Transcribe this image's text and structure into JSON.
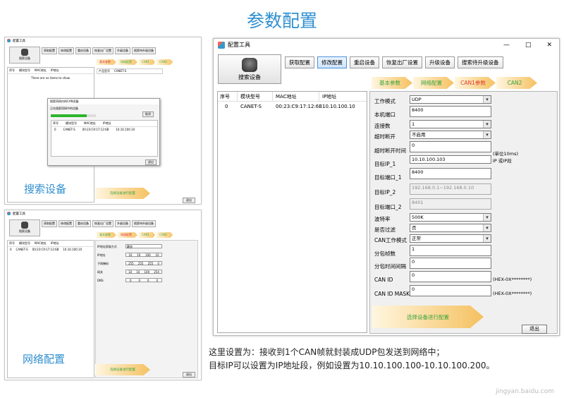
{
  "page_title": "参数配置",
  "captions": {
    "search": "搜索设备",
    "network": "网络配置"
  },
  "thumb1": {
    "title": "配置工具",
    "search_label": "搜索设备",
    "buttons": [
      "获取配置",
      "修改配置",
      "重启设备",
      "恢复出厂设置",
      "升级设备",
      "搜索待升级设备"
    ],
    "tabs": [
      "基本参数",
      "网络配置",
      "CAN1",
      "CAN2"
    ],
    "cols": [
      "序号",
      "模块型号",
      "MAC地址",
      "IP地址"
    ],
    "empty": "There are no items to show.",
    "dialog_title": "搜索同网内的CAN设备",
    "dialog_msg": "正在搜索同网中的设备",
    "dialog_cancel": "取消",
    "dialog_cols": [
      "序号",
      "模块型号",
      "MAC地址",
      "IP地址"
    ],
    "dialog_row": [
      "0",
      "CANET-S",
      "00:23:C9:17:12:6B",
      "10.10.100.10"
    ],
    "dialog_ok": "退出",
    "side_label": "产品型号",
    "side_value": "CANET-S",
    "apply": "选择设备进行配置",
    "exit": "退出"
  },
  "thumb2": {
    "title": "配置工具",
    "search_label": "搜索设备",
    "buttons": [
      "获取配置",
      "修改配置",
      "重启设备",
      "恢复出厂设置",
      "升级设备",
      "搜索待升级设备"
    ],
    "tabs": [
      "基本参数",
      "网络配置",
      "CAN1",
      "CAN2"
    ],
    "cols": [
      "序号",
      "模块型号",
      "MAC地址",
      "IP地址"
    ],
    "row": [
      "0",
      "CANET-S",
      "00:23:C9:17:12:6B",
      "10.10.100.10"
    ],
    "labels": [
      "IP地址获取方式",
      "IP地址",
      "子网掩码",
      "网关",
      "DNS"
    ],
    "mode": "静态",
    "ip": [
      "10",
      "10",
      "100",
      "10"
    ],
    "mask": [
      "255",
      "255",
      "255",
      "0"
    ],
    "gw": [
      "10",
      "10",
      "100",
      "254"
    ],
    "dns": [
      "0",
      "0",
      "0",
      "0"
    ],
    "apply": "选择设备进行配置",
    "exit": "退出"
  },
  "main": {
    "title": "配置工具",
    "controls": {
      "min": "—",
      "max": "□",
      "close": "✕"
    },
    "search_label": "搜索设备",
    "buttons": [
      "获取配置",
      "修改配置",
      "重启设备",
      "恢复出厂设置",
      "升级设备",
      "搜索待升级设备"
    ],
    "tabs": [
      "基本参数",
      "网络配置",
      "CAN1参数",
      "CAN2"
    ],
    "cols": [
      "序号",
      "模块型号",
      "MAC地址",
      "IP地址"
    ],
    "row": [
      "0",
      "CANET-S",
      "00:23:C9:17:12:6B",
      "10.10.100.10"
    ],
    "fields": {
      "work_mode_label": "工作模式",
      "work_mode": "UDP",
      "local_port_label": "本机端口",
      "local_port": "8400",
      "conn_label": "连接数",
      "conn": "1",
      "timeout_label": "超时断开",
      "timeout": "不启用",
      "timeout_time_label": "超时断开时间",
      "timeout_time": "0",
      "timeout_unit": "(单位10ms)",
      "target_ip1_label": "目标IP_1",
      "target_ip1": "10.10.100.103",
      "target_ip1_note": "IP 或IP段",
      "target_port1_label": "目标端口_1",
      "target_port1": "8400",
      "target_ip2_label": "目标IP_2",
      "target_ip2": "192.168.0.1~192.168.0.10",
      "target_port2_label": "目标端口_2",
      "target_port2": "8401",
      "baud_label": "波特率",
      "baud": "500K",
      "filter_label": "是否过滤",
      "filter": "否",
      "can_mode_label": "CAN工作模式",
      "can_mode": "正常",
      "pkt_frames_label": "分包帧数",
      "pkt_frames": "1",
      "pkt_interval_label": "分包时间间隔",
      "pkt_interval": "0",
      "can_id_label": "CAN ID",
      "can_id": "0",
      "can_id_note": "(HEX-0X********)",
      "can_mask_label": "CAN ID MASK",
      "can_mask": "0",
      "can_mask_note": "(HEX-0X********)"
    },
    "apply": "选择设备进行配置",
    "exit": "退出"
  },
  "description": {
    "line1": "这里设置为：接收到1个CAN帧就封装成UDP包发送到网络中；",
    "line2": "目标IP可以设置为IP地址段，例如设置为10.10.100.100-10.10.100.200。"
  },
  "watermark": "jingyan.baidu.com"
}
